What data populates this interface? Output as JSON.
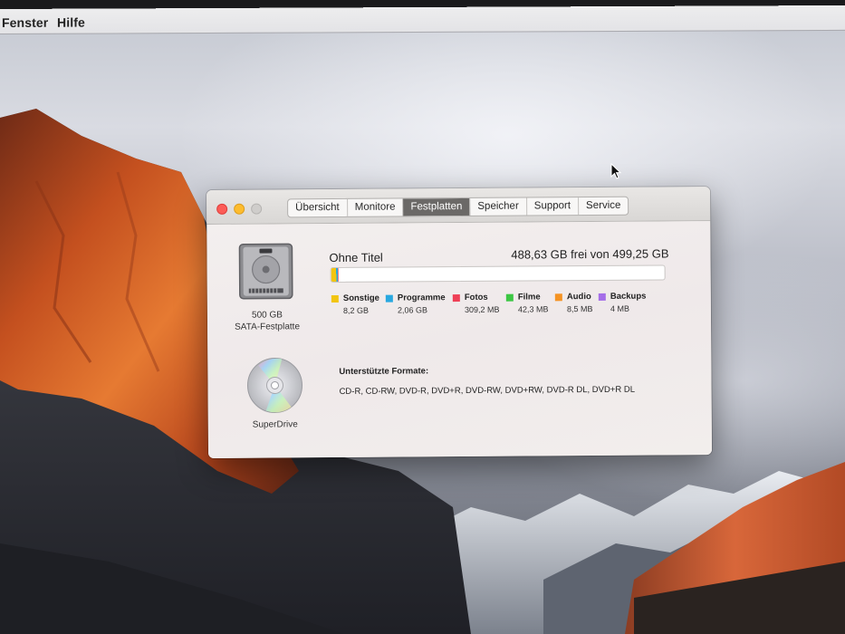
{
  "menubar": {
    "items": [
      "Fenster",
      "Hilfe"
    ]
  },
  "window": {
    "tabs": [
      {
        "label": "Übersicht",
        "active": false
      },
      {
        "label": "Monitore",
        "active": false
      },
      {
        "label": "Festplatten",
        "active": true
      },
      {
        "label": "Speicher",
        "active": false
      },
      {
        "label": "Support",
        "active": false
      },
      {
        "label": "Service",
        "active": false
      }
    ],
    "drives": {
      "hdd": {
        "icon": "hard-drive-icon",
        "capacity": "500 GB",
        "type": "SATA-Festplatte"
      },
      "optical": {
        "icon": "superdrive-disc-icon",
        "name": "SuperDrive"
      }
    },
    "disk": {
      "name": "Ohne Titel",
      "free_text": "488,63 GB frei von 499,25 GB",
      "used_fraction": 0.0213
    },
    "legend": [
      {
        "label": "Sonstige",
        "value": "8,2 GB",
        "color": "#f2c511"
      },
      {
        "label": "Programme",
        "value": "2,06 GB",
        "color": "#28a8e0"
      },
      {
        "label": "Fotos",
        "value": "309,2 MB",
        "color": "#ee4056"
      },
      {
        "label": "Filme",
        "value": "42,3 MB",
        "color": "#3cc743"
      },
      {
        "label": "Audio",
        "value": "8,5 MB",
        "color": "#f59323"
      },
      {
        "label": "Backups",
        "value": "4 MB",
        "color": "#a56ee8"
      }
    ],
    "formats": {
      "title": "Unterstützte Formate:",
      "list": "CD-R, CD-RW, DVD-R, DVD+R, DVD-RW, DVD+RW, DVD-R DL, DVD+R DL"
    }
  }
}
